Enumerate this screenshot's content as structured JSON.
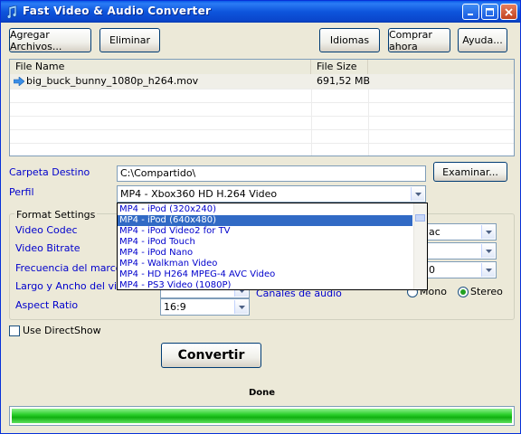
{
  "window": {
    "title": "Fast Video & Audio Converter"
  },
  "toolbar": {
    "add_files": "Agregar Archivos...",
    "remove": "Eliminar",
    "languages": "Idiomas",
    "buy_now": "Comprar ahora",
    "help": "Ayuda..."
  },
  "file_list": {
    "columns": [
      "File Name",
      "File Size"
    ],
    "rows": [
      {
        "name": "big_buck_bunny_1080p_h264.mov",
        "size": "691,52 MB"
      }
    ]
  },
  "destination": {
    "label": "Carpeta Destino",
    "value": "C:\\Compartido\\",
    "browse": "Examinar..."
  },
  "profile": {
    "label": "Perfil",
    "selected": "MP4 - Xbox360 HD H.264 Video",
    "options": [
      "MP4 - iPod (320x240)",
      "MP4 - iPod (640x480)",
      "MP4 - iPod Video2 for TV",
      "MP4 - iPod Touch",
      "MP4 - iPod Nano",
      "MP4 - Walkman Video",
      "MP4 - HD H264 MPEG-4 AVC Video",
      "MP4 - PS3 Video (1080P)"
    ],
    "highlighted_index": 1
  },
  "format_settings": {
    "title": "Format Settings",
    "video_codec": "Video Codec",
    "video_bitrate": "Video Bitrate",
    "frame_rate": "Frecuencia del marco de v",
    "size": "Largo y Ancho del video de",
    "aspect_ratio": "Aspect Ratio",
    "aspect_ratio_value": "16:9",
    "audio_channels_label": "Canales de audio",
    "audio_codec_partial": "ac",
    "audio_rate_partial": "0",
    "mono": "Mono",
    "stereo": "Stereo"
  },
  "use_directshow": "Use DirectShow",
  "convert": "Convertir",
  "status": "Done",
  "progress_fraction": 1.0
}
